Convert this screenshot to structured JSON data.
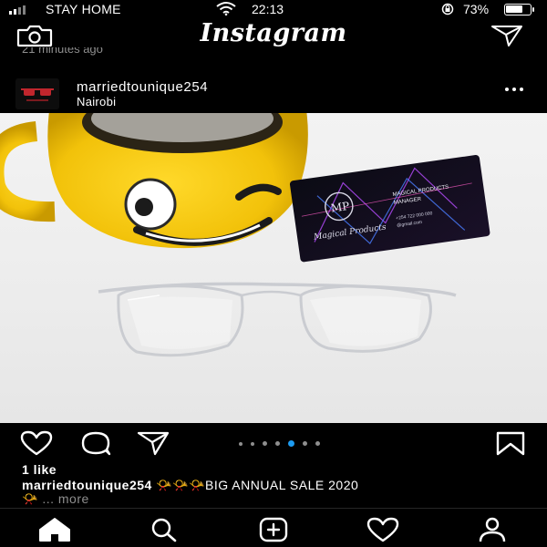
{
  "status_bar": {
    "carrier": "STAY HOME",
    "time": "22:13",
    "battery_percent": "73%",
    "battery_level": 0.73
  },
  "header": {
    "brand": "Instagram",
    "icons": [
      "camera-icon",
      "direct-message-icon"
    ]
  },
  "previous_post_time": "21 minutes ago",
  "post": {
    "username": "marriedtounique254",
    "location": "Nairobi",
    "carousel": {
      "count": 7,
      "active_index": 4
    },
    "likes": "1 like",
    "caption_user": "marriedtounique254",
    "caption_text": "BIG ANNUAL SALE 2020",
    "caption_emoji": "📯",
    "more_label": "... more",
    "photo_card": {
      "brand_script": "Magical Products",
      "monogram": "MP",
      "title": "MAGICAL PRODUCTS",
      "name": "MANAGER",
      "phone": "+254 722 000 000",
      "email": "@gmail.com"
    }
  },
  "bottom_nav": {
    "items": [
      "home-icon",
      "search-icon",
      "new-post-icon",
      "activity-icon",
      "profile-icon"
    ]
  },
  "colors": {
    "background": "#000000",
    "text": "#ffffff",
    "muted": "#8e8e8e",
    "active_dot": "#1d9bf0",
    "mug_yellow": "#f2c40c"
  }
}
